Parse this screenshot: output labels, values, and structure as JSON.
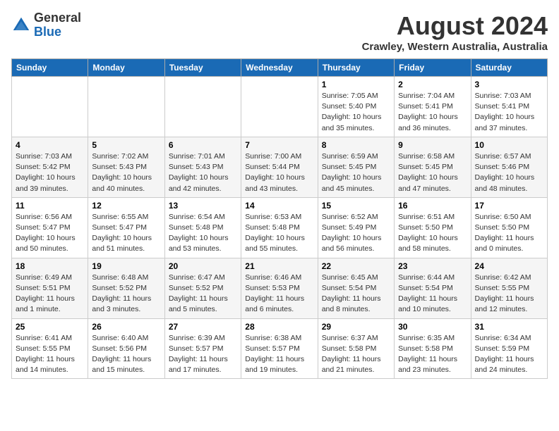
{
  "header": {
    "logo_general": "General",
    "logo_blue": "Blue",
    "month_title": "August 2024",
    "subtitle": "Crawley, Western Australia, Australia"
  },
  "weekdays": [
    "Sunday",
    "Monday",
    "Tuesday",
    "Wednesday",
    "Thursday",
    "Friday",
    "Saturday"
  ],
  "weeks": [
    [
      {
        "day": "",
        "info": ""
      },
      {
        "day": "",
        "info": ""
      },
      {
        "day": "",
        "info": ""
      },
      {
        "day": "",
        "info": ""
      },
      {
        "day": "1",
        "info": "Sunrise: 7:05 AM\nSunset: 5:40 PM\nDaylight: 10 hours\nand 35 minutes."
      },
      {
        "day": "2",
        "info": "Sunrise: 7:04 AM\nSunset: 5:41 PM\nDaylight: 10 hours\nand 36 minutes."
      },
      {
        "day": "3",
        "info": "Sunrise: 7:03 AM\nSunset: 5:41 PM\nDaylight: 10 hours\nand 37 minutes."
      }
    ],
    [
      {
        "day": "4",
        "info": "Sunrise: 7:03 AM\nSunset: 5:42 PM\nDaylight: 10 hours\nand 39 minutes."
      },
      {
        "day": "5",
        "info": "Sunrise: 7:02 AM\nSunset: 5:43 PM\nDaylight: 10 hours\nand 40 minutes."
      },
      {
        "day": "6",
        "info": "Sunrise: 7:01 AM\nSunset: 5:43 PM\nDaylight: 10 hours\nand 42 minutes."
      },
      {
        "day": "7",
        "info": "Sunrise: 7:00 AM\nSunset: 5:44 PM\nDaylight: 10 hours\nand 43 minutes."
      },
      {
        "day": "8",
        "info": "Sunrise: 6:59 AM\nSunset: 5:45 PM\nDaylight: 10 hours\nand 45 minutes."
      },
      {
        "day": "9",
        "info": "Sunrise: 6:58 AM\nSunset: 5:45 PM\nDaylight: 10 hours\nand 47 minutes."
      },
      {
        "day": "10",
        "info": "Sunrise: 6:57 AM\nSunset: 5:46 PM\nDaylight: 10 hours\nand 48 minutes."
      }
    ],
    [
      {
        "day": "11",
        "info": "Sunrise: 6:56 AM\nSunset: 5:47 PM\nDaylight: 10 hours\nand 50 minutes."
      },
      {
        "day": "12",
        "info": "Sunrise: 6:55 AM\nSunset: 5:47 PM\nDaylight: 10 hours\nand 51 minutes."
      },
      {
        "day": "13",
        "info": "Sunrise: 6:54 AM\nSunset: 5:48 PM\nDaylight: 10 hours\nand 53 minutes."
      },
      {
        "day": "14",
        "info": "Sunrise: 6:53 AM\nSunset: 5:48 PM\nDaylight: 10 hours\nand 55 minutes."
      },
      {
        "day": "15",
        "info": "Sunrise: 6:52 AM\nSunset: 5:49 PM\nDaylight: 10 hours\nand 56 minutes."
      },
      {
        "day": "16",
        "info": "Sunrise: 6:51 AM\nSunset: 5:50 PM\nDaylight: 10 hours\nand 58 minutes."
      },
      {
        "day": "17",
        "info": "Sunrise: 6:50 AM\nSunset: 5:50 PM\nDaylight: 11 hours\nand 0 minutes."
      }
    ],
    [
      {
        "day": "18",
        "info": "Sunrise: 6:49 AM\nSunset: 5:51 PM\nDaylight: 11 hours\nand 1 minute."
      },
      {
        "day": "19",
        "info": "Sunrise: 6:48 AM\nSunset: 5:52 PM\nDaylight: 11 hours\nand 3 minutes."
      },
      {
        "day": "20",
        "info": "Sunrise: 6:47 AM\nSunset: 5:52 PM\nDaylight: 11 hours\nand 5 minutes."
      },
      {
        "day": "21",
        "info": "Sunrise: 6:46 AM\nSunset: 5:53 PM\nDaylight: 11 hours\nand 6 minutes."
      },
      {
        "day": "22",
        "info": "Sunrise: 6:45 AM\nSunset: 5:54 PM\nDaylight: 11 hours\nand 8 minutes."
      },
      {
        "day": "23",
        "info": "Sunrise: 6:44 AM\nSunset: 5:54 PM\nDaylight: 11 hours\nand 10 minutes."
      },
      {
        "day": "24",
        "info": "Sunrise: 6:42 AM\nSunset: 5:55 PM\nDaylight: 11 hours\nand 12 minutes."
      }
    ],
    [
      {
        "day": "25",
        "info": "Sunrise: 6:41 AM\nSunset: 5:55 PM\nDaylight: 11 hours\nand 14 minutes."
      },
      {
        "day": "26",
        "info": "Sunrise: 6:40 AM\nSunset: 5:56 PM\nDaylight: 11 hours\nand 15 minutes."
      },
      {
        "day": "27",
        "info": "Sunrise: 6:39 AM\nSunset: 5:57 PM\nDaylight: 11 hours\nand 17 minutes."
      },
      {
        "day": "28",
        "info": "Sunrise: 6:38 AM\nSunset: 5:57 PM\nDaylight: 11 hours\nand 19 minutes."
      },
      {
        "day": "29",
        "info": "Sunrise: 6:37 AM\nSunset: 5:58 PM\nDaylight: 11 hours\nand 21 minutes."
      },
      {
        "day": "30",
        "info": "Sunrise: 6:35 AM\nSunset: 5:58 PM\nDaylight: 11 hours\nand 23 minutes."
      },
      {
        "day": "31",
        "info": "Sunrise: 6:34 AM\nSunset: 5:59 PM\nDaylight: 11 hours\nand 24 minutes."
      }
    ]
  ]
}
